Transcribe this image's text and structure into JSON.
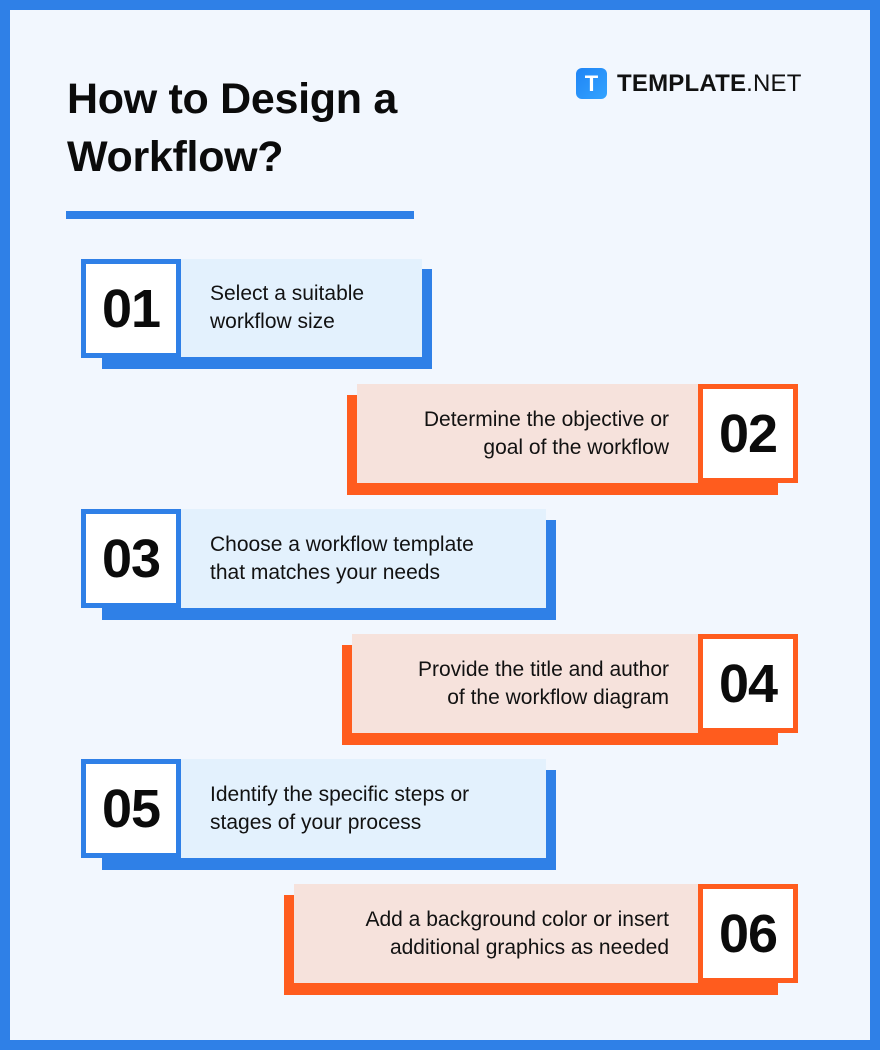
{
  "header": {
    "title": "How to Design a Workflow?",
    "brand": {
      "icon": "T",
      "name_bold": "TEMPLATE",
      "name_light": ".NET"
    }
  },
  "colors": {
    "frame": "#2f80e7",
    "background": "#f2f7fe",
    "blue_accent": "#2f80e7",
    "blue_panel": "#e3f1fd",
    "orange_accent": "#ff5c1e",
    "orange_panel": "#f6e2dc"
  },
  "steps": [
    {
      "number": "01",
      "text": "Select a suitable workflow size",
      "line1": "Select a suitable",
      "line2": "workflow size",
      "color": "blue"
    },
    {
      "number": "02",
      "text": "Determine the objective or goal of the workflow",
      "line1": "Determine the objective or",
      "line2": "goal of the workflow",
      "color": "orange"
    },
    {
      "number": "03",
      "text": "Choose a workflow template that matches your needs",
      "line1": "Choose a workflow template",
      "line2": "that matches your needs",
      "color": "blue"
    },
    {
      "number": "04",
      "text": "Provide the title and author of the workflow diagram",
      "line1": "Provide the title and author",
      "line2": "of the workflow diagram",
      "color": "orange"
    },
    {
      "number": "05",
      "text": "Identify the specific steps or stages of your process",
      "line1": "Identify the specific steps or",
      "line2": "stages of your process",
      "color": "blue"
    },
    {
      "number": "06",
      "text": "Add a background color or insert additional graphics as needed",
      "line1": "Add a background color or insert",
      "line2": "additional graphics as needed",
      "color": "orange"
    }
  ]
}
